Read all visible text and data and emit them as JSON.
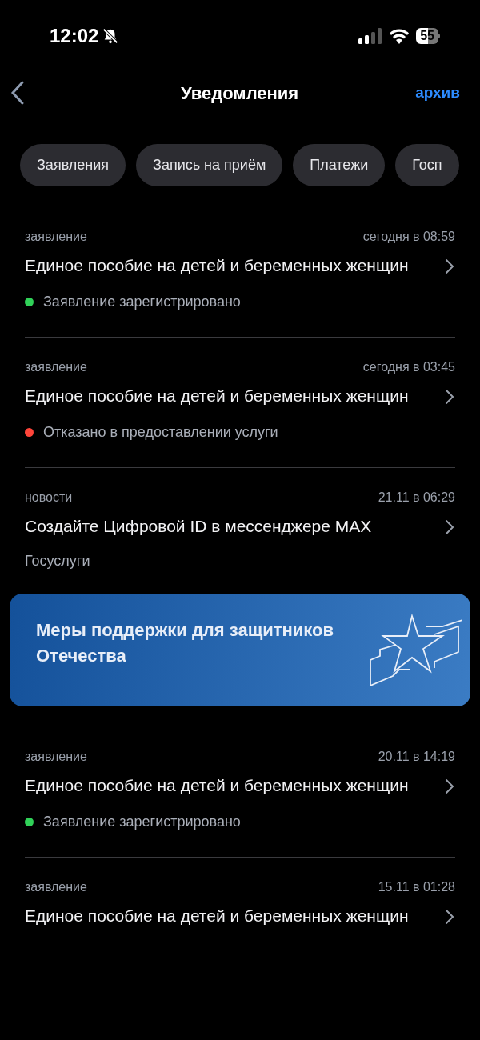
{
  "status_bar": {
    "time": "12:02",
    "battery": "55"
  },
  "header": {
    "title": "Уведомления",
    "action": "архив"
  },
  "filters": [
    {
      "label": "Заявления"
    },
    {
      "label": "Запись на приём"
    },
    {
      "label": "Платежи"
    },
    {
      "label": "Госп"
    }
  ],
  "items": [
    {
      "kind": "notification",
      "category": "заявление",
      "time": "сегодня в 08:59",
      "title": "Единое пособие на детей и беременных женщин",
      "footer": {
        "kind": "status",
        "text": "Заявление зарегистрировано",
        "color": "#30d158"
      }
    },
    {
      "kind": "notification",
      "category": "заявление",
      "time": "сегодня в 03:45",
      "title": "Единое пособие на детей и беременных женщин",
      "footer": {
        "kind": "status",
        "text": "Отказано в предоставлении услуги",
        "color": "#ff453a"
      }
    },
    {
      "kind": "notification",
      "category": "новости",
      "time": "21.11 в 06:29",
      "title": "Создайте Цифровой ID в мессенджере MAX",
      "footer": {
        "kind": "source",
        "text": "Госуслуги"
      }
    },
    {
      "kind": "banner",
      "title": "Меры поддержки для защитников Отечества"
    },
    {
      "kind": "notification",
      "category": "заявление",
      "time": "20.11 в 14:19",
      "title": "Единое пособие на детей и беременных женщин",
      "footer": {
        "kind": "status",
        "text": "Заявление зарегистрировано",
        "color": "#30d158"
      }
    },
    {
      "kind": "notification",
      "category": "заявление",
      "time": "15.11 в 01:28",
      "title": "Единое пособие на детей и беременных женщин"
    }
  ]
}
